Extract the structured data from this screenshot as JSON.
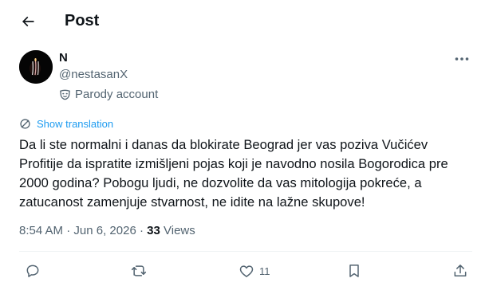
{
  "header": {
    "title": "Post",
    "back_icon": "arrow-left-icon"
  },
  "author": {
    "name": "N",
    "handle": "@nestasanX",
    "badge_label": "Parody account",
    "badge_icon": "mask-icon",
    "avatar_icon": "candle-avatar"
  },
  "translate": {
    "label": "Show translation",
    "icon": "globe-translate-icon"
  },
  "tweet": {
    "text": "Da li ste normalni i danas da blokirate Beograd jer vas poziva Vučićev Profitije da ispratite izmišljeni pojas koji je navodno nosila Bogorodica pre 2000 godina? Pobogu ljudi, ne dozvolite da vas mitologija pokreće, a zatucanost zamenjuje stvarnost, ne idite na lažne skupove!"
  },
  "meta": {
    "time": "8:54 AM",
    "separator": "·",
    "date": "Jun 6, 2026",
    "views_count": "33",
    "views_label": "Views"
  },
  "actions": {
    "reply_icon": "reply-icon",
    "repost_icon": "repost-icon",
    "like_icon": "heart-icon",
    "like_count": "11",
    "bookmark_icon": "bookmark-icon",
    "share_icon": "share-icon"
  },
  "colors": {
    "accent": "#1d9bf0",
    "muted": "#536471",
    "text": "#0f1419",
    "divider": "#eff3f4"
  }
}
